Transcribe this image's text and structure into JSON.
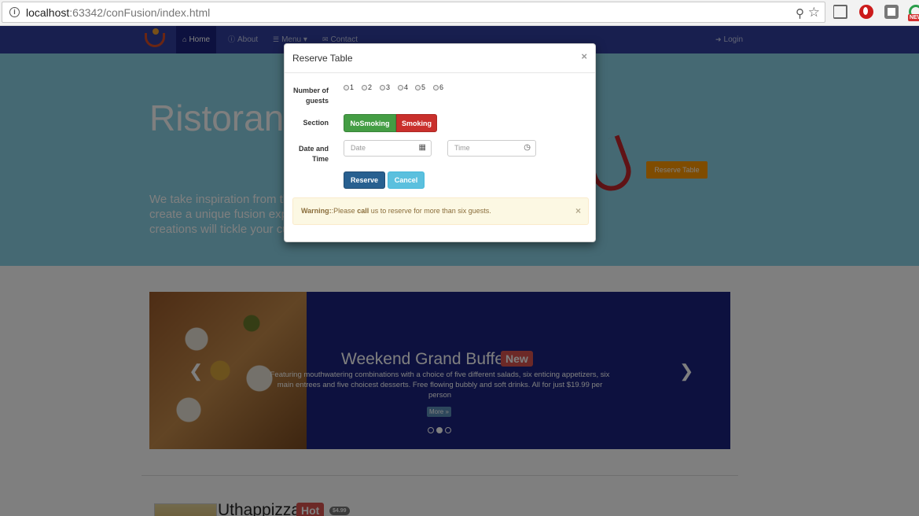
{
  "browser": {
    "url_host": "localhost",
    "url_rest": ":63342/conFusion/index.html",
    "info_icon": "info-icon",
    "ext_badge": "NEW"
  },
  "nav": {
    "home": "Home",
    "about": "About",
    "menu": "Menu",
    "contact": "Contact",
    "login": "Login"
  },
  "jumbotron": {
    "title": "Ristorante con Fusion",
    "lead": "We take inspiration from the World's best cuisines, and create a unique fusion experience. Our lipsmacking creations will tickle your culinary senses!",
    "reserve_btn": "Reserve Table"
  },
  "carousel": {
    "title": "Weekend Grand Buffet",
    "badge": "New",
    "text": "Featuring mouthwatering combinations with a choice of five different salads, six enticing appetizers, six main entrees and five choicest desserts. Free flowing bubbly and soft drinks. All for just $19.99 per person",
    "more": "More »",
    "active_slide": 2
  },
  "featured": {
    "title": "Uthappizza",
    "badge": "Hot",
    "price": "$4.99"
  },
  "modal": {
    "title": "Reserve Table",
    "close": "×",
    "guests_label": "Number of guests",
    "guests": [
      "1",
      "2",
      "3",
      "4",
      "5",
      "6"
    ],
    "section_label": "Section",
    "section_nosmoking": "NoSmoking",
    "section_smoking": "Smoking",
    "datetime_label": "Date and Time",
    "date_placeholder": "Date",
    "time_placeholder": "Time",
    "reserve_btn": "Reserve",
    "cancel_btn": "Cancel",
    "alert_strong": "Warning:",
    "alert_pre": ":Please ",
    "alert_call": "call",
    "alert_post": " us to reserve for more than six guests.",
    "alert_close": "×"
  },
  "colors": {
    "navbar": "#303F9F",
    "success": "#449d44",
    "danger": "#c9302c",
    "primary": "#286090",
    "info": "#5bc0de"
  }
}
